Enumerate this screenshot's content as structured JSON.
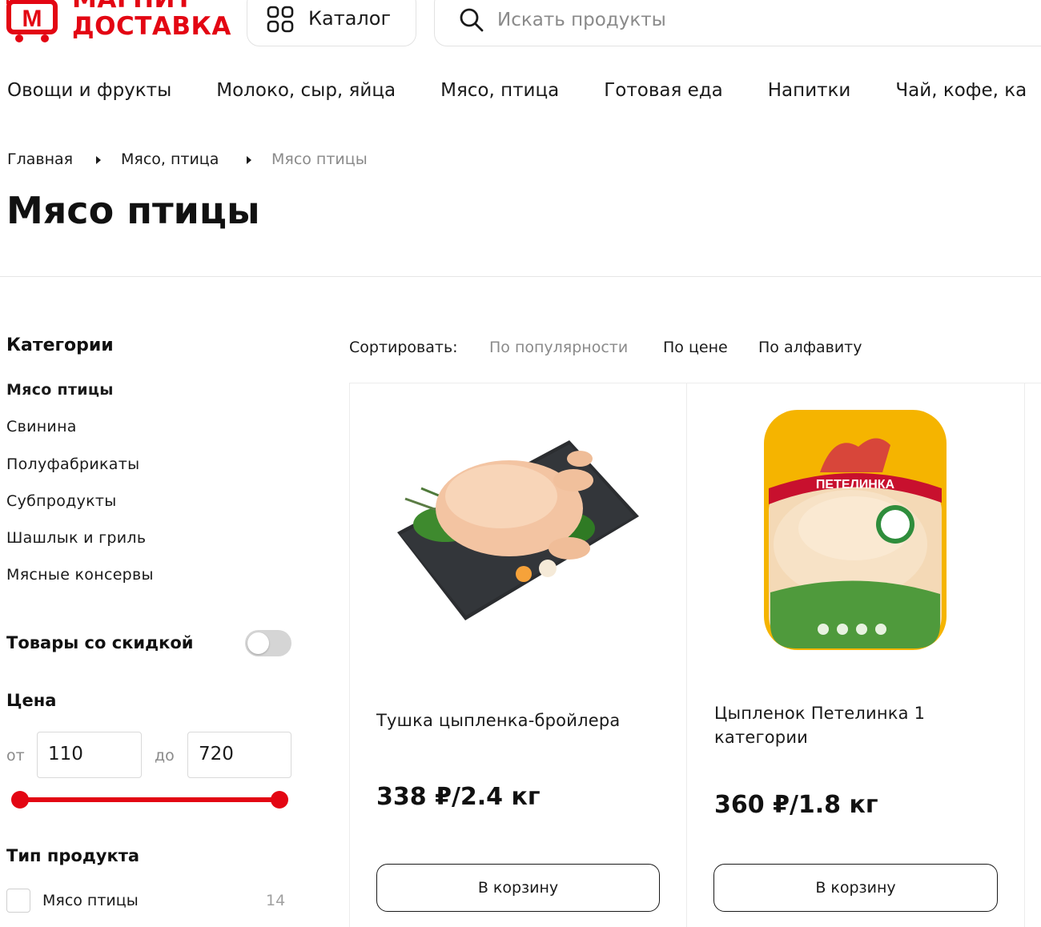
{
  "header": {
    "logo_line1": "МАГНИТ",
    "logo_line2": "ДОСТАВКА",
    "logo_mark_letter": "М",
    "catalog_label": "Каталог",
    "search_placeholder": "Искать продукты",
    "brand_color": "#e30613"
  },
  "categories_nav": [
    "Овощи и фрукты",
    "Молоко, сыр, яйца",
    "Мясо, птица",
    "Готовая еда",
    "Напитки",
    "Чай, кофе, ка"
  ],
  "breadcrumb": [
    "Главная",
    "Мясо, птица",
    "Мясо птицы"
  ],
  "page_title": "Мясо птицы",
  "sidebar": {
    "categories_title": "Категории",
    "categories": [
      "Мясо птицы",
      "Свинина",
      "Полуфабрикаты",
      "Субпродукты",
      "Шашлык и гриль",
      "Мясные консервы"
    ],
    "active_category": "Мясо птицы",
    "discount_label": "Товары со скидкой",
    "discount_enabled": false,
    "price_title": "Цена",
    "price_from_label": "от",
    "price_to_label": "до",
    "price_from": "110",
    "price_to": "720",
    "product_type_title": "Тип продукта",
    "product_types": [
      {
        "label": "Мясо птицы",
        "count": "14",
        "checked": false
      }
    ]
  },
  "sort": {
    "label": "Сортировать:",
    "options": [
      "По популярности",
      "По цене",
      "По алфавиту"
    ],
    "active": "По популярности"
  },
  "products": [
    {
      "name": "Тушка цыпленка-бройлера",
      "price": "338 ₽/2.4 кг",
      "button": "В корзину",
      "image": "raw-chicken-on-slate-image"
    },
    {
      "name": "Цыпленок Петелинка 1 категории",
      "price": "360 ₽/1.8 кг",
      "button": "В корзину",
      "image": "packaged-chicken-image",
      "package_brand": "ПЕТЕЛИНКА"
    }
  ]
}
